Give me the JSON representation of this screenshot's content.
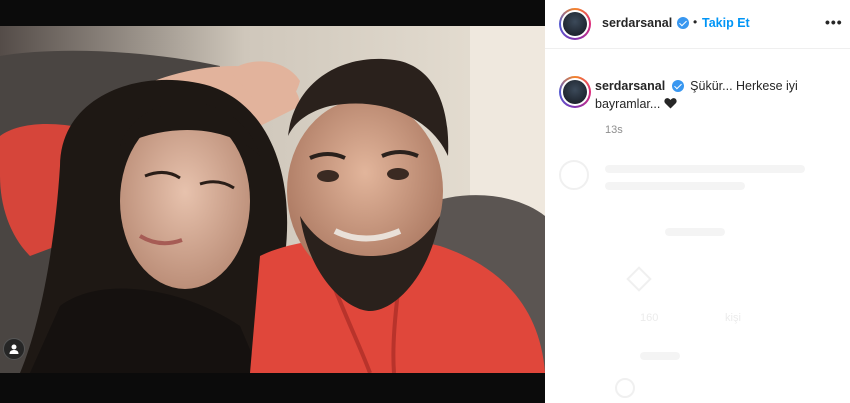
{
  "post": {
    "username": "serdarsanal",
    "follow_label": "Takip Et",
    "separator": "•",
    "more_label": "•••",
    "caption_text": "Şükür... Herkese iyi bayramlar...",
    "caption_emoji": "black-heart",
    "timestamp": "13s"
  },
  "faded_panel": {
    "likes": "160",
    "likes_suffix": "kişi"
  },
  "icons": {
    "verified": "verified-badge-icon",
    "more": "more-options-icon",
    "user_tag": "user-tag-icon",
    "heart": "black-heart-icon"
  },
  "colors": {
    "link": "#0095f6",
    "verified": "#3897f0",
    "text": "#262626",
    "muted": "#8e8e8e"
  }
}
